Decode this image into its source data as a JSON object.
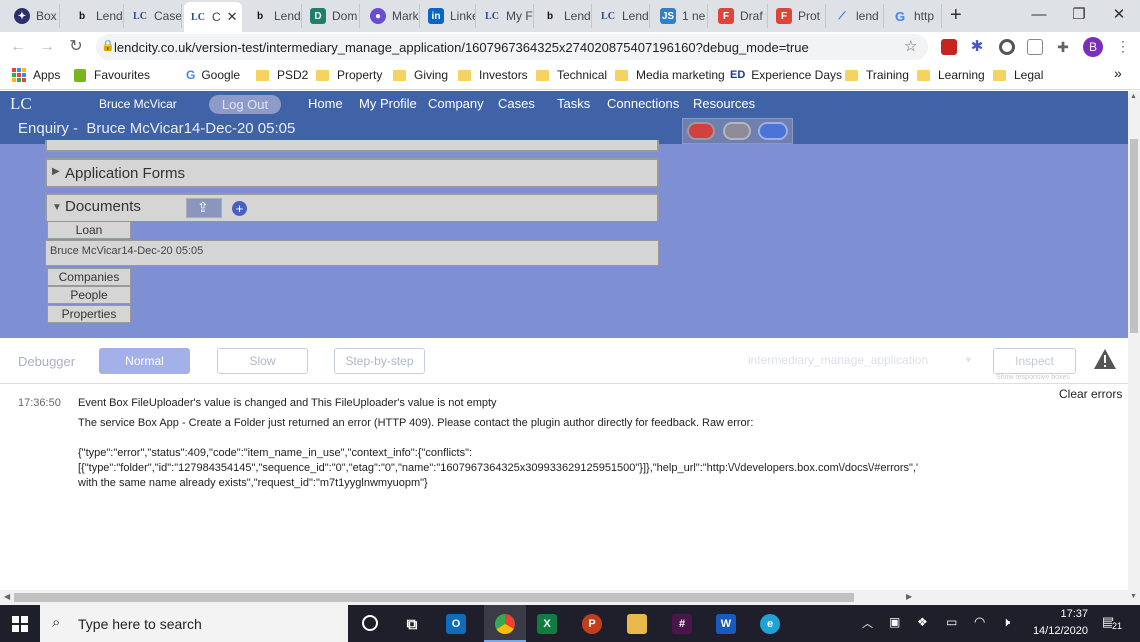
{
  "browser": {
    "tabs": [
      {
        "label": "Box",
        "icon": "box-icon"
      },
      {
        "label": "Lend",
        "icon": "bubble-icon"
      },
      {
        "label": "Case",
        "icon": "lc-icon"
      },
      {
        "label": "C",
        "icon": "lc-icon"
      },
      {
        "label": "Lend",
        "icon": "bubble-icon"
      },
      {
        "label": "Dom",
        "icon": "doc-icon"
      },
      {
        "label": "Mark",
        "icon": "circle-icon"
      },
      {
        "label": "Linke",
        "icon": "linkedin-icon"
      },
      {
        "label": "My F",
        "icon": "lc-icon"
      },
      {
        "label": "Lend",
        "icon": "bubble-icon"
      },
      {
        "label": "Lend",
        "icon": "lc-icon"
      },
      {
        "label": "1 ne",
        "icon": "js-icon"
      },
      {
        "label": "Draf",
        "icon": "figma-icon"
      },
      {
        "label": "Prot",
        "icon": "figma-icon"
      },
      {
        "label": "lend",
        "icon": "link-icon"
      },
      {
        "label": "http",
        "icon": "google-icon"
      }
    ],
    "new_tab": "+",
    "url": "lendcity.co.uk/version-test/intermediary_manage_application/1607967364325x274020875407196160?debug_mode=true",
    "avatar_letter": "B",
    "bookmarks": [
      "Apps",
      "Favourites",
      "Google",
      "PSD2",
      "Property",
      "Giving",
      "Investors",
      "Technical",
      "Media marketing",
      "Experience Days",
      "Training",
      "Learning",
      "Legal"
    ],
    "bookmarks_more": "»"
  },
  "app": {
    "logo": "LC",
    "user": "Bruce McVicar",
    "logout": "Log Out",
    "nav": [
      "Home",
      "My Profile",
      "Company",
      "Cases",
      "Tasks",
      "Connections",
      "Resources"
    ],
    "enquiry_title": "Enquiry -  Bruce McVicar14-Dec-20 05:05",
    "application_forms": "Application Forms",
    "documents": "Documents",
    "loan_tab": "Loan",
    "loan_item": "Bruce McVicar14-Dec-20 05:05",
    "side_tabs": [
      "Companies",
      "People",
      "Properties"
    ]
  },
  "debugger": {
    "label": "Debugger",
    "modes": [
      "Normal",
      "Slow",
      "Step-by-step"
    ],
    "element_select": "intermediary_manage_application",
    "inspect": "Inspect",
    "hint": "Show responsive boxes",
    "clear": "Clear errors",
    "log_time": "17:36:50",
    "log_event": "Event Box FileUploader's value is changed and This FileUploader's value is not empty",
    "log_error": "The service Box App - Create a Folder just returned an error (HTTP 409). Please contact the plugin author directly for feedback. Raw error:",
    "raw1": "{\"type\":\"error\",\"status\":409,\"code\":\"item_name_in_use\",\"context_info\":{\"conflicts\":",
    "raw2": "[{\"type\":\"folder\",\"id\":\"127984354145\",\"sequence_id\":\"0\",\"etag\":\"0\",\"name\":\"1607967364325x309933629125951500\"}]},\"help_url\":\"http:\\/\\/developers.box.com\\/docs\\/#errors\",\"mes",
    "raw3": "with the same name already exists\",\"request_id\":\"m7t1yyglnwmyuopm\"}"
  },
  "taskbar": {
    "search_placeholder": "Type here to search",
    "time": "17:37",
    "date": "14/12/2020",
    "notif_count": "21"
  },
  "colors": {
    "app_blue": "#3f63a6",
    "app_body": "#7f8fd3",
    "normal_btn": "#a4b0e8"
  }
}
